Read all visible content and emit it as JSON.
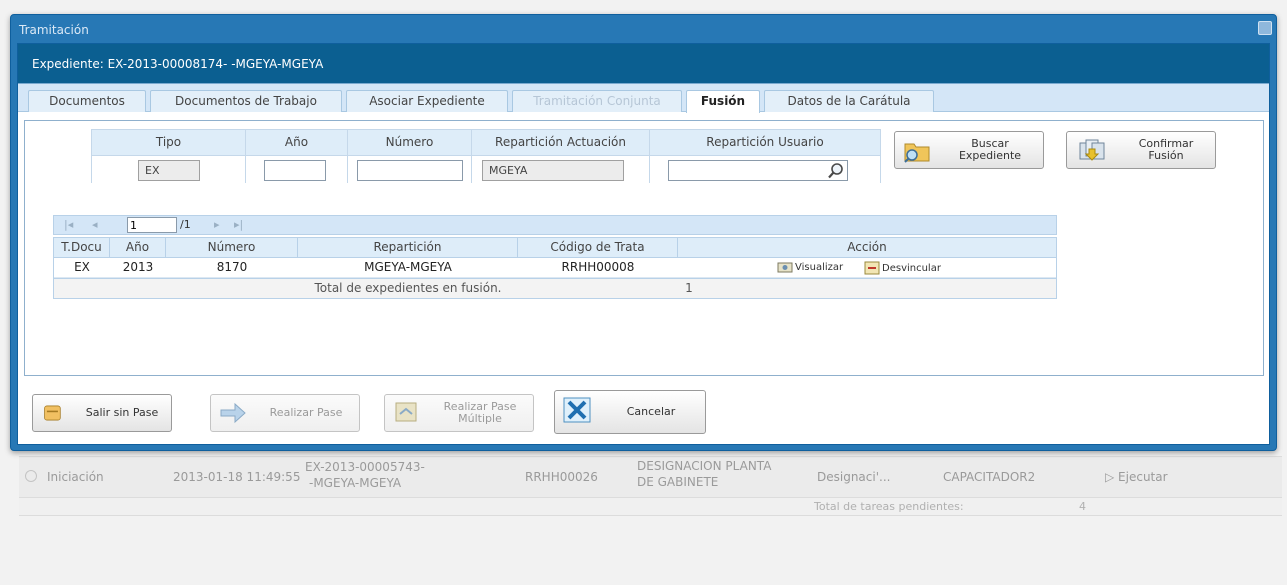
{
  "window": {
    "title": "Tramitación",
    "expediente_label": "Expediente: EX-2013-00008174- -MGEYA-MGEYA"
  },
  "tabs": [
    {
      "label": "Documentos",
      "state": "normal"
    },
    {
      "label": "Documentos de Trabajo",
      "state": "normal"
    },
    {
      "label": "Asociar Expediente",
      "state": "normal"
    },
    {
      "label": "Tramitación Conjunta",
      "state": "disabled"
    },
    {
      "label": "Fusión",
      "state": "active"
    },
    {
      "label": "Datos de la Carátula",
      "state": "normal"
    }
  ],
  "search": {
    "headers": {
      "tipo": "Tipo",
      "anio": "Año",
      "numero": "Número",
      "reparticion_actuacion": "Repartición Actuación",
      "reparticion_usuario": "Repartición Usuario"
    },
    "values": {
      "tipo": "EX",
      "anio": "",
      "numero": "",
      "reparticion_actuacion": "MGEYA",
      "reparticion_usuario": ""
    },
    "buscar_label_1": "Buscar",
    "buscar_label_2": "Expediente",
    "confirmar_label_1": "Confirmar",
    "confirmar_label_2": "Fusión"
  },
  "pager": {
    "page": "1",
    "of": "/1"
  },
  "grid": {
    "headers": {
      "tdocu": "T.Docu",
      "anio": "Año",
      "numero": "Número",
      "reparticion": "Repartición",
      "codigo": "Código de Trata",
      "accion": "Acción"
    },
    "rows": [
      {
        "tdocu": "EX",
        "anio": "2013",
        "numero": "8170",
        "reparticion": "MGEYA-MGEYA",
        "codigo": "RRHH00008",
        "visualizar": "Visualizar",
        "desvincular": "Desvincular"
      }
    ],
    "footer_label": "Total de expedientes en fusión.",
    "footer_count": "1"
  },
  "actions": {
    "salir": "Salir sin Pase",
    "realizar": "Realizar Pase",
    "multiple_1": "Realizar Pase",
    "multiple_2": "Múltiple",
    "cancelar": "Cancelar"
  },
  "background": {
    "estado": "Iniciación",
    "fecha": "2013-01-18 11:49:55",
    "expediente_1": "EX-2013-00005743-",
    "expediente_2": "-MGEYA-MGEYA",
    "codigo": "RRHH00026",
    "descripcion_1": "DESIGNACION PLANTA",
    "descripcion_2": "DE GABINETE",
    "motivo": "Designaci'...",
    "usuario": "CAPACITADOR2",
    "ejecutar": "Ejecutar",
    "total_label": "Total de tareas pendientes:",
    "total_count": "4"
  }
}
